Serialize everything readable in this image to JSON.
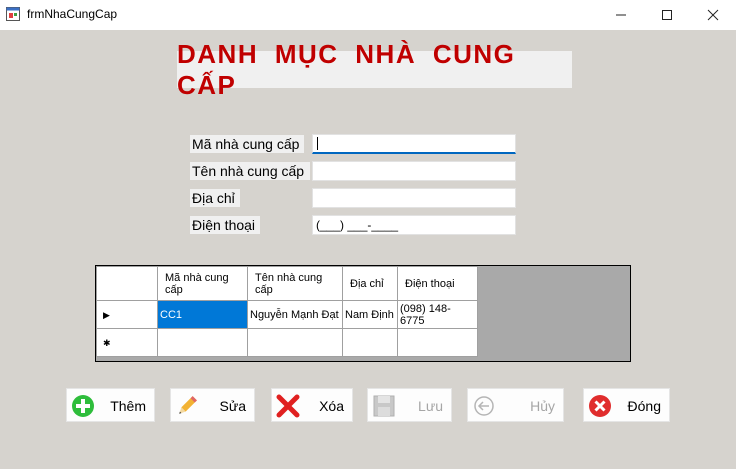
{
  "window": {
    "title": "frmNhaCungCap"
  },
  "heading": "DANH MỤC NHÀ CUNG CẤP",
  "fields": [
    {
      "label": "Mã nhà cung cấp",
      "value": ""
    },
    {
      "label": "Tên nhà cung cấp",
      "value": ""
    },
    {
      "label": "Địa chỉ",
      "value": ""
    },
    {
      "label": "Điện thoại",
      "value": "(___) ___-____"
    }
  ],
  "grid": {
    "columns": [
      "Mã nhà cung cấp",
      "Tên nhà cung cấp",
      "Địa chỉ",
      "Điện thoại"
    ],
    "rows": [
      [
        "CC1",
        "Nguyễn Mạnh Đạt",
        "Nam Định",
        "(098) 148-6775"
      ]
    ]
  },
  "buttons": {
    "add": "Thêm",
    "edit": "Sửa",
    "delete": "Xóa",
    "save": "Lưu",
    "cancel": "Hủy",
    "close": "Đóng"
  },
  "colors": {
    "heading": "#c00000",
    "selection": "#0078d7",
    "form_bg": "#d6d3ce"
  }
}
